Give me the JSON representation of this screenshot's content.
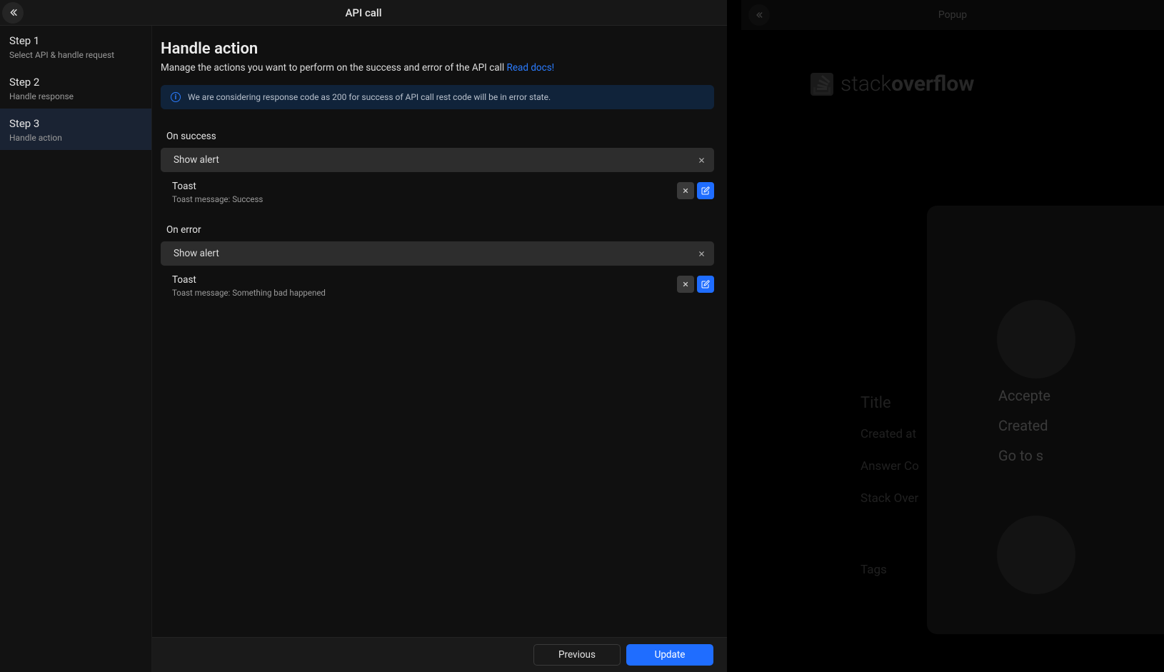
{
  "modal": {
    "title": "API call",
    "steps": [
      {
        "title": "Step 1",
        "sub": "Select API & handle request"
      },
      {
        "title": "Step 2",
        "sub": "Handle response"
      },
      {
        "title": "Step 3",
        "sub": "Handle action"
      }
    ],
    "active_step_index": 2,
    "page_title": "Handle action",
    "page_sub_text": "Manage the actions you want to perform on the success and error of the API call ",
    "page_sub_link": "Read docs!",
    "info_banner": "We are considering response code as 200 for success of API call rest code will be in error state.",
    "sections": {
      "success": {
        "label": "On success",
        "action_value": "Show alert",
        "toast_title": "Toast",
        "toast_message_prefix": "Toast message: ",
        "toast_message": "Success"
      },
      "error": {
        "label": "On error",
        "action_value": "Show alert",
        "toast_title": "Toast",
        "toast_message_prefix": "Toast message: ",
        "toast_message": "Something bad happened"
      }
    },
    "footer": {
      "previous": "Previous",
      "update": "Update"
    }
  },
  "background": {
    "popup_title": "Popup",
    "logo_part1": "stack",
    "logo_part2": "overflow",
    "card": {
      "accepted": "Accepte",
      "created": "Created",
      "goto": "Go to s"
    },
    "labels": {
      "title": "Title",
      "created": "Created at",
      "answer": "Answer Co",
      "stack": "Stack Over",
      "tags": "Tags"
    }
  }
}
